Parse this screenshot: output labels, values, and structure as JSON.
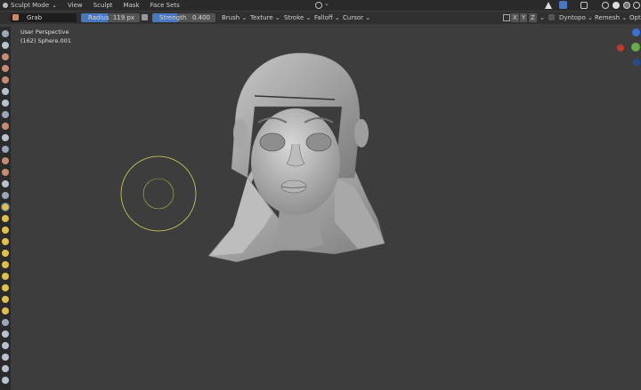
{
  "header": {
    "mode": "Sculpt Mode",
    "menu": [
      "View",
      "Sculpt",
      "Mask",
      "Face Sets"
    ]
  },
  "toolbar": {
    "brush_name": "Grab",
    "radius_label": "Radius",
    "radius_value": "119 px",
    "strength_label": "Strength",
    "strength_value": "0.400",
    "menus": [
      "Brush",
      "Texture",
      "Stroke",
      "Falloff",
      "Cursor"
    ],
    "symmetry": [
      "X",
      "Y",
      "Z"
    ],
    "dyntopo": "Dyntopo",
    "remesh": "Remesh",
    "options": "Opti"
  },
  "viewport": {
    "view_name": "User Perspective",
    "object_info": "(162) Sphere.001"
  },
  "colors": {
    "accent": "#4a78c0",
    "radius_fill": "#4a78c0",
    "brush_cursor": "#d4d45a",
    "gizmo_x": "#c0392b",
    "gizmo_y": "#6aa84f",
    "gizmo_z": "#3e6fd1"
  },
  "left_toolbar_icons": [
    "draw-icon",
    "draw-sharp-icon",
    "clay-icon",
    "clay-strips-icon",
    "clay-thumb-icon",
    "layer-icon",
    "inflate-icon",
    "blob-icon",
    "crease-icon",
    "smooth-icon",
    "flatten-icon",
    "fill-icon",
    "scrape-icon",
    "multires-icon",
    "pinch-icon",
    "grab-icon",
    "elastic-icon",
    "snake-hook-icon",
    "thumb-icon",
    "pose-icon",
    "nudge-icon",
    "rotate-icon",
    "slide-relax-icon",
    "boundary-icon",
    "cloth-icon",
    "simplify-icon",
    "mask-icon",
    "draw-face-sets-icon",
    "box-mask-icon",
    "lasso-mask-icon",
    "annotate-icon"
  ]
}
